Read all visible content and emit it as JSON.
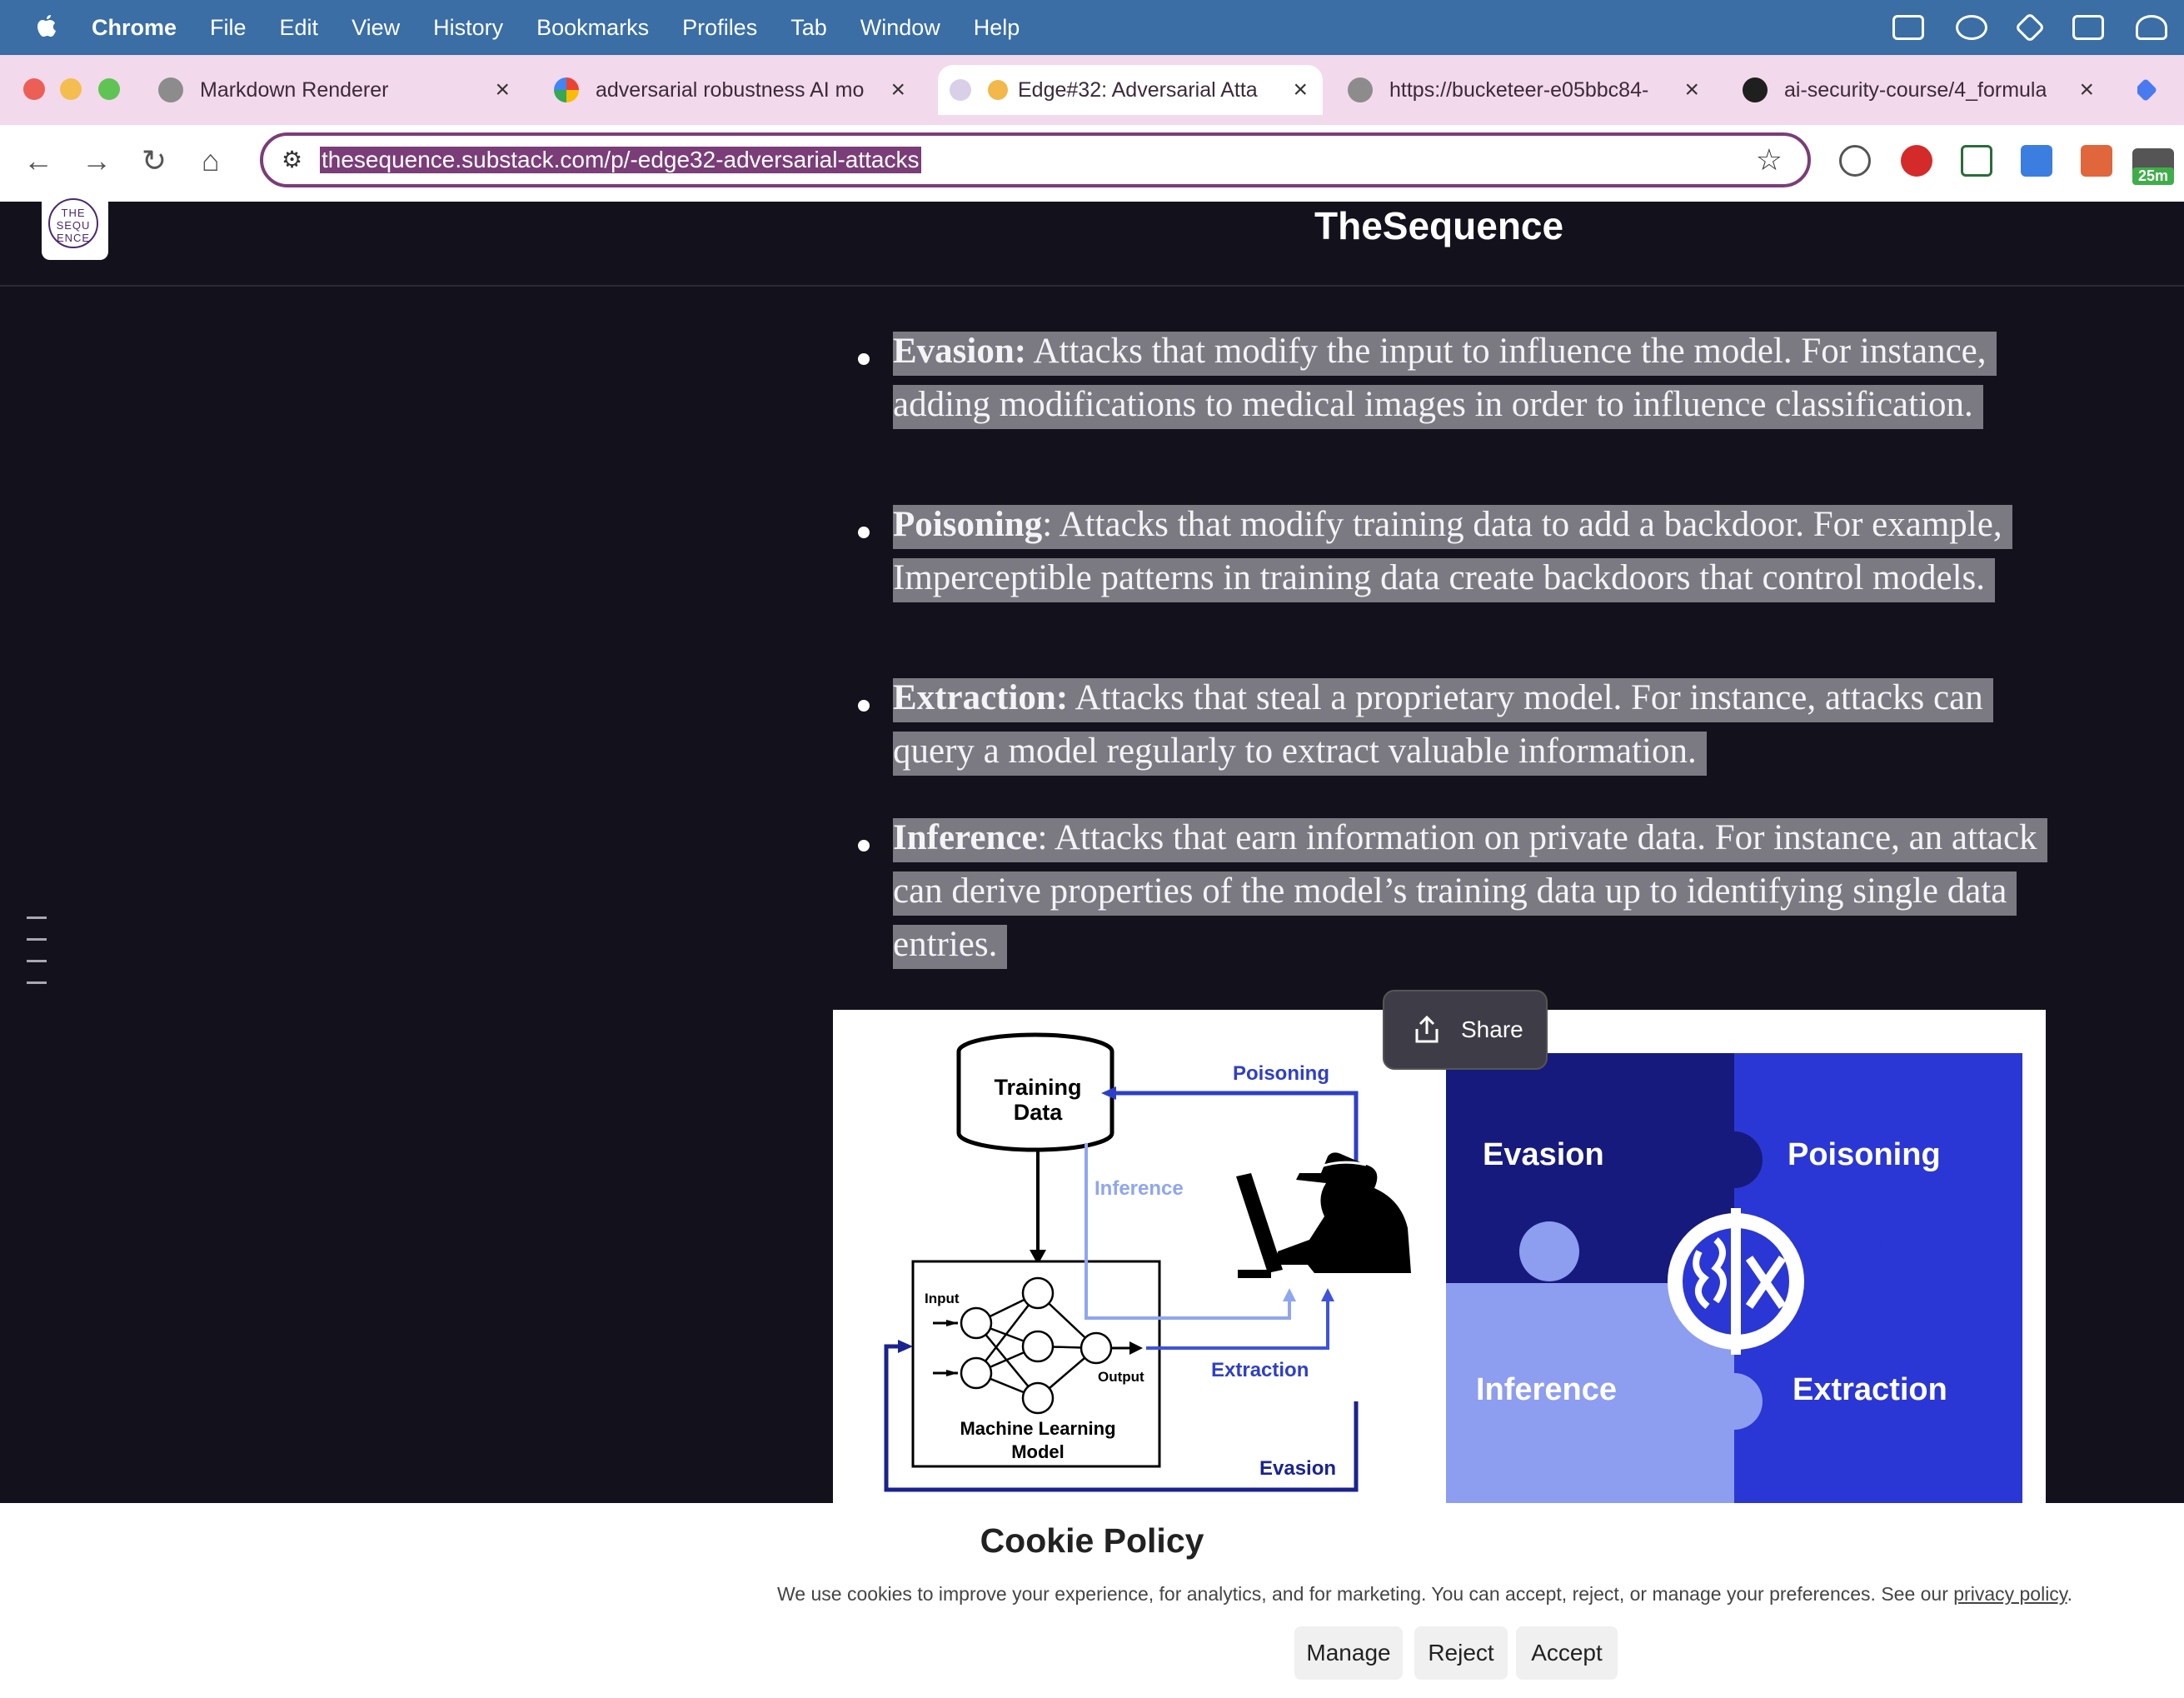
{
  "menubar": {
    "app": "Chrome",
    "items": [
      "File",
      "Edit",
      "View",
      "History",
      "Bookmarks",
      "Profiles",
      "Tab",
      "Window",
      "Help"
    ]
  },
  "tabs": [
    {
      "title": "Markdown Renderer"
    },
    {
      "title": "adversarial robustness AI mo"
    },
    {
      "title": "Edge#32: Adversarial Atta"
    },
    {
      "title": "https://bucketeer-e05bbc84-"
    },
    {
      "title": "ai-security-course/4_formula"
    }
  ],
  "toolbar": {
    "url": "thesequence.substack.com/p/-edge32-adversarial-attacks",
    "timer_badge": "25m"
  },
  "page": {
    "logo_text": "THE SEQU ENCE",
    "site_name": "TheSequence",
    "bullets": [
      {
        "term": "Evasion:",
        "text": " Attacks that modify the input to influence the model. For instance, adding modifications to medical images in order to influence classification. "
      },
      {
        "term": "Poisoning",
        "text": ": Attacks that modify training data to add a backdoor. For example, Imperceptible patterns in training data create backdoors that control models. "
      },
      {
        "term": "Extraction:",
        "text": " Attacks that steal a proprietary model. For instance, attacks can query a model regularly to extract valuable information. "
      },
      {
        "term": "Inference",
        "text": ": Attacks that earn information on private data. For instance, an attack can derive properties of the model’s training data up to identifying single data entries. "
      }
    ],
    "share_label": "Share"
  },
  "figure": {
    "diagram": {
      "training_data": "Training Data",
      "poisoning": "Poisoning",
      "inference": "Inference",
      "extraction": "Extraction",
      "evasion": "Evasion",
      "input": "Input",
      "output": "Output",
      "model": "Machine Learning Model"
    },
    "puzzle": {
      "top_left": "Evasion",
      "top_right": "Poisoning",
      "bottom_left": "Inference",
      "bottom_right": "Extraction"
    }
  },
  "cookie": {
    "title": "Cookie Policy",
    "text": "We use cookies to improve your experience, for analytics, and for marketing. You can accept, reject, or manage your preferences. See our ",
    "link": "privacy policy",
    "period": ".",
    "buttons": {
      "manage": "Manage",
      "reject": "Reject",
      "accept": "Accept"
    }
  },
  "colors": {
    "menubar": "#3a6ea5",
    "tabstrip": "#f3d9ec",
    "page_bg": "#13121c",
    "highlight": "#7b7a83",
    "puzzle_dark": "#1a1d8c",
    "puzzle_mid": "#2b36d4",
    "puzzle_light": "#8f9ef2"
  }
}
